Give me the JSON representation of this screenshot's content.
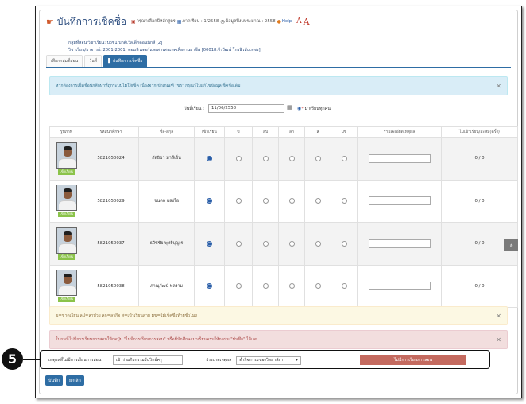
{
  "header": {
    "title": "บันทึกการเช็คชื่อ",
    "subject_hint": "กรุณาเลือกปีหลักสูตร",
    "term": "ภาคเรียน : 1/2558",
    "year": "ข้อมูลปีงบประมาณ : 2558",
    "help": "Help",
    "font_small": "A",
    "font_large": "A"
  },
  "info": {
    "group": "กลุ่มที่สอน/วิชาเรียน: ปวช1 ปกติเวิลเด็กคอนนิกส์ [2]",
    "course": "วิชาเรียน/อาจารย์: 2001-2001: คอมพิวเตอร์และสารสนเทศเพื่องานอาชีพ [00018:จีรวัฒน์ โกรธิวสันเพชร]"
  },
  "tabs": [
    {
      "label": "เลือกกลุ่มที่สอน"
    },
    {
      "label": "วันที่"
    },
    {
      "label": "บันทึกการเช็คชื่อ"
    }
  ],
  "alert_info": "หากต้องการเช็คชื่อนักศึกษาที่ถูกระบบไม่ให้เช็ค เนื่องจากเข้าเกณฑ์ \"ขร\" กรุณาไปแก้ไขข้อมูลเช็คชื่อเดิม",
  "date_row": {
    "label": "วันที่เรียน :",
    "value": "11/06/2558",
    "all_label": "มาเรียนทุกคน"
  },
  "table": {
    "headers": [
      "รูปภาพ",
      "รหัสนักศึกษา",
      "ชื่อ-สกุล",
      "เข้าเรียน",
      "ข",
      "ลป",
      "ลก",
      "ส",
      "มข",
      "รายละเอียดเหตุผล",
      "ไม่เข้าเรียน/สะสม(ครั้ง)"
    ],
    "present_tag": "เข้าเรียน",
    "rows": [
      {
        "id": "5821050024",
        "name": "กัลยิมา มาลีเย็น",
        "count": "0 / 0"
      },
      {
        "id": "5821050029",
        "name": "ชนดล แสงไอ",
        "count": "0 / 0"
      },
      {
        "id": "5821050037",
        "name": "ธวัชชัย พุทธิบุญเร",
        "count": "0 / 0"
      },
      {
        "id": "5821050038",
        "name": "ภาณุวัฒน์ พลงาม",
        "count": "0 / 0"
      }
    ]
  },
  "alert_warning": "ข=ขาดเรียน ลป=ลาป่วย ลก=ลากิจ ส=เข้าเรียนสาย มข=ไม่เช็คชื่อท้ายชั่วโมง",
  "alert_danger": "ในกรณีไม่มีการเรียนการสอนให้กดปุ่ม \"ไม่มีการเรียนการสอน\" หรือมีนักศึกษามาเรียนครบให้กดปุ่ม \"บันทึก\" ได้เลย",
  "noclass": {
    "reason_label": "เหตุผลที่ไม่มีการเรียนการสอน",
    "reason_value": "เข้าร่วมกิจกรรมวันวิทย์ครู",
    "type_label": "ประเภทเหตุผล",
    "type_value": "ทำกิจกรรมของวิทยาลัยฯ",
    "button": "ไม่มีการเรียนการสอน"
  },
  "callout_number": "5",
  "actions": {
    "save": "บันทึก",
    "cancel": "ยกเลิก"
  },
  "scroll_top_icon": "double-chevron-up"
}
